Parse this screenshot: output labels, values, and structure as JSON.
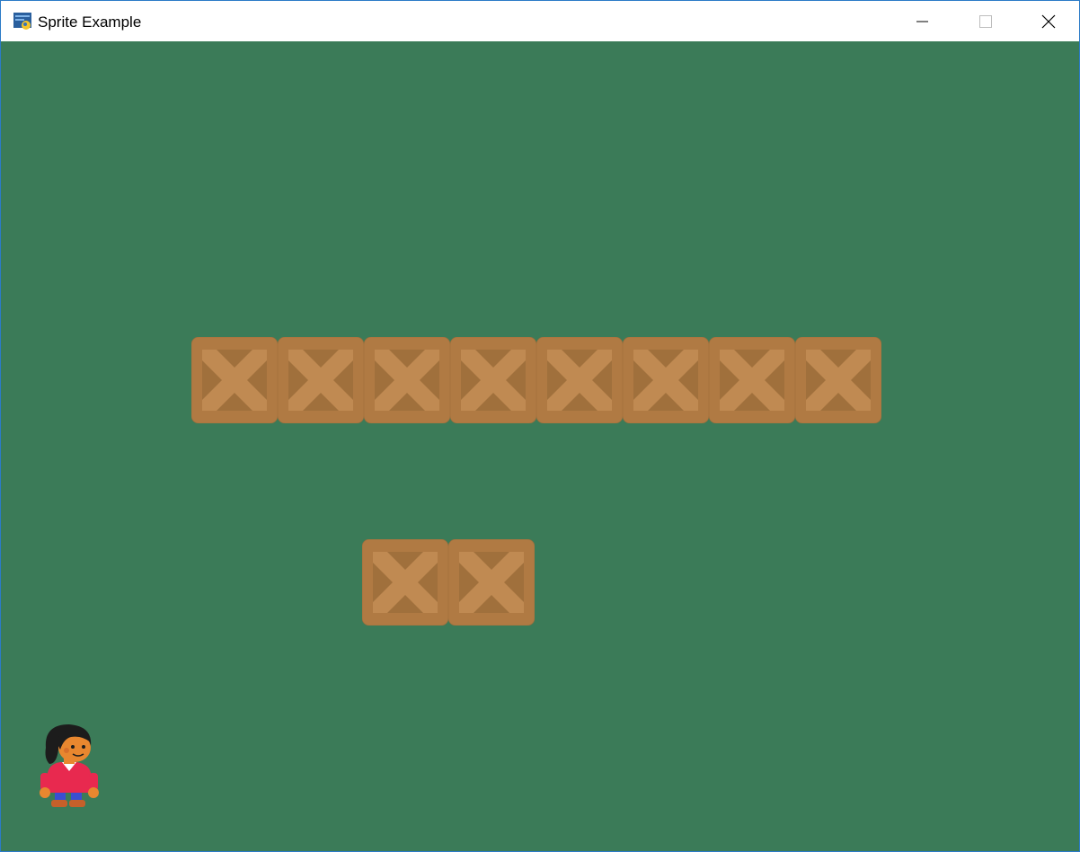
{
  "window": {
    "title": "Sprite Example",
    "icon": "python-app-icon",
    "controls": {
      "minimize": "minimize-icon",
      "maximize": "maximize-icon",
      "close": "close-icon"
    }
  },
  "game": {
    "background_color": "#3b7b58",
    "crate_colors": {
      "frame": "#b07a43",
      "panel": "#a0703c",
      "plank": "#c08a52"
    },
    "sprites": {
      "crate_row_top": {
        "count": 8,
        "sprite": "crate"
      },
      "crate_row_bottom": {
        "count": 2,
        "sprite": "crate"
      },
      "player": {
        "sprite": "character-player"
      }
    }
  }
}
